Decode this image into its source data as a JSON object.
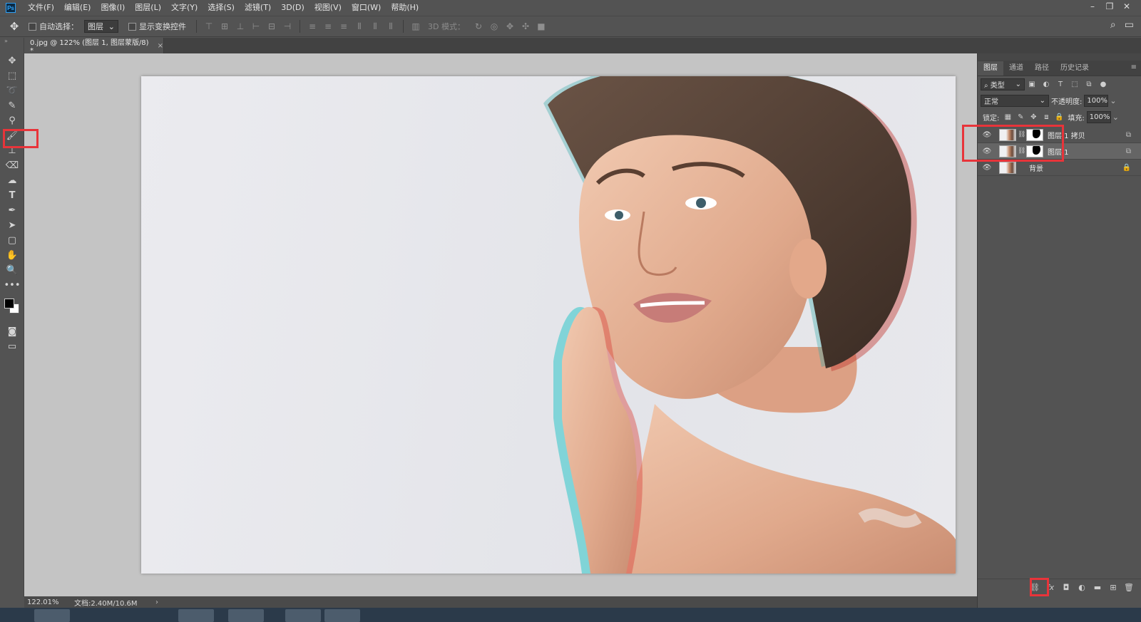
{
  "app": {
    "logo": "Ps"
  },
  "menu": [
    "文件(F)",
    "编辑(E)",
    "图像(I)",
    "图层(L)",
    "文字(Y)",
    "选择(S)",
    "滤镜(T)",
    "3D(D)",
    "视图(V)",
    "窗口(W)",
    "帮助(H)"
  ],
  "options": {
    "auto_select_label": "自动选择：",
    "auto_select_value": "图层",
    "show_transform_label": "显示变换控件",
    "mode_3d_label": "3D 模式："
  },
  "document": {
    "tab_title": "0.jpg @ 122% (图层 1, 图层蒙版/8) *",
    "close": "×"
  },
  "status": {
    "zoom": "122.01%",
    "doc_size": "文档:2.40M/10.6M",
    "arrow": "›"
  },
  "panel": {
    "tabs": [
      "图层",
      "通道",
      "路径",
      "历史记录"
    ],
    "filter_value": "类型",
    "blend_mode": "正常",
    "opacity_label": "不透明度:",
    "opacity_value": "100%",
    "lock_label": "锁定:",
    "fill_label": "填充:",
    "fill_value": "100%",
    "layers": [
      {
        "name": "图层 1 拷贝",
        "has_mask": true,
        "selected": false
      },
      {
        "name": "图层 1",
        "has_mask": true,
        "selected": true
      },
      {
        "name": "背景",
        "has_mask": false,
        "locked": true
      }
    ]
  },
  "colors": {
    "highlight": "#e8343a",
    "foreground": "#000000",
    "background": "#ffffff"
  }
}
